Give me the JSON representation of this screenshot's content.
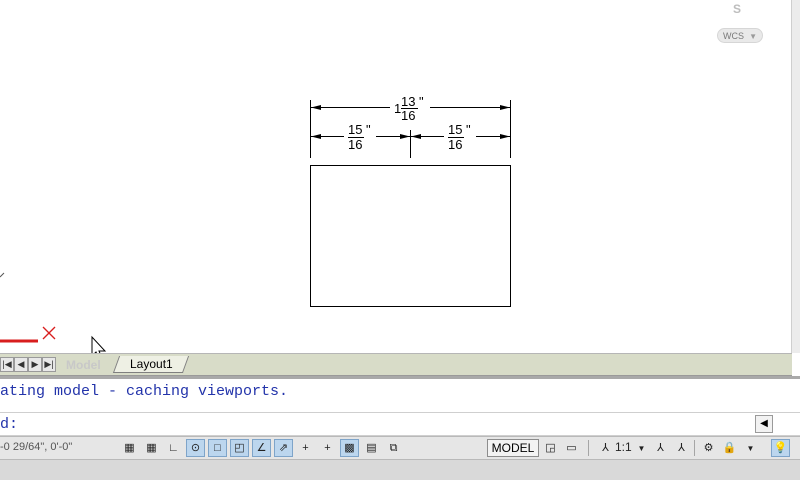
{
  "viewport": {
    "viewcube_label": "S",
    "wcs_label": "WCS",
    "dimensions": {
      "overall": {
        "whole": "1",
        "num": "13",
        "den": "16",
        "unit": "\""
      },
      "left": {
        "num": "15",
        "den": "16",
        "unit": "\""
      },
      "right": {
        "num": "15",
        "den": "16",
        "unit": "\""
      }
    },
    "cursor_icon": "arrow-cursor"
  },
  "tabs": {
    "nav_first": "|◀",
    "nav_prev": "◀",
    "nav_next": "▶",
    "nav_last": "▶|",
    "model_label": "Model",
    "layout1_label": "Layout1"
  },
  "command": {
    "history_line": "ating model - caching viewports.",
    "prompt": "d:"
  },
  "status": {
    "coordinates": "-0 29/64\", 0'-0\"",
    "model_button": "MODEL",
    "annotation_scale": "1:1",
    "toggles": [
      {
        "name": "infer-constraints-icon",
        "glyph": "▦",
        "on": false
      },
      {
        "name": "snap-mode-icon",
        "glyph": "▦",
        "on": false
      },
      {
        "name": "grid-display-icon",
        "glyph": "∟",
        "on": false
      },
      {
        "name": "ortho-mode-icon",
        "glyph": "⊙",
        "on": true
      },
      {
        "name": "polar-tracking-icon",
        "glyph": "□",
        "on": true
      },
      {
        "name": "object-snap-icon",
        "glyph": "◰",
        "on": true
      },
      {
        "name": "3d-object-snap-icon",
        "glyph": "∠",
        "on": true
      },
      {
        "name": "object-snap-tracking-icon",
        "glyph": "⇗",
        "on": true
      },
      {
        "name": "dynamic-ucs-icon",
        "glyph": "+",
        "on": false
      },
      {
        "name": "dynamic-input-icon",
        "glyph": "+",
        "on": false
      },
      {
        "name": "lineweight-icon",
        "glyph": "▩",
        "on": true
      },
      {
        "name": "transparency-icon",
        "glyph": "▤",
        "on": false
      },
      {
        "name": "selection-cycling-icon",
        "glyph": "⧉",
        "on": false
      }
    ]
  }
}
